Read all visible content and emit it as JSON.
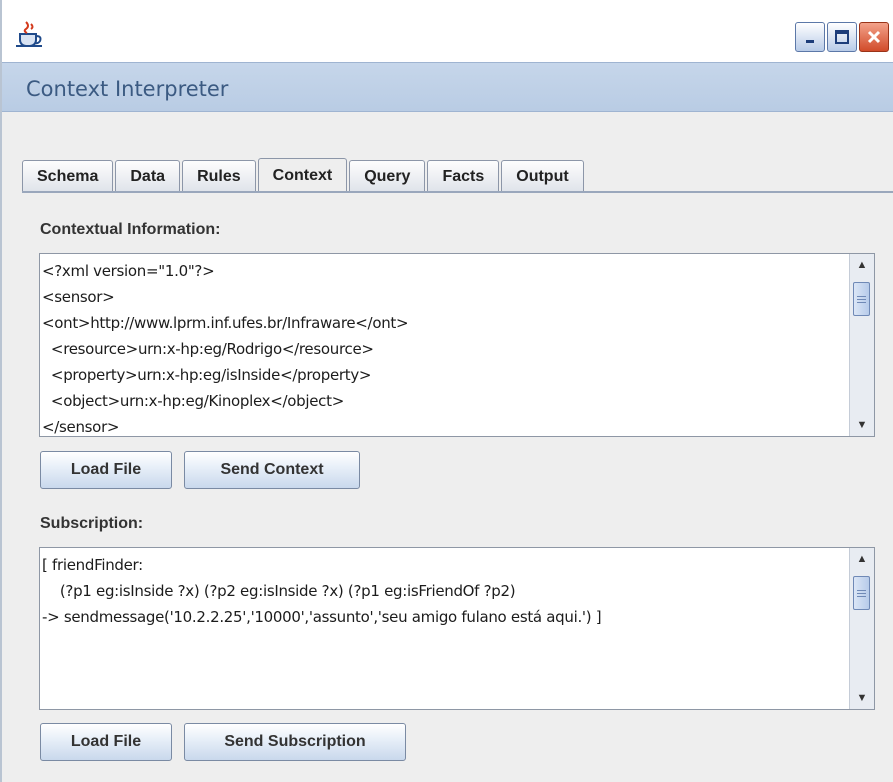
{
  "window": {
    "icon": "java-cup-icon",
    "header_title": "Context Interpreter"
  },
  "tabs": [
    {
      "label": "Schema"
    },
    {
      "label": "Data"
    },
    {
      "label": "Rules"
    },
    {
      "label": "Context",
      "active": true
    },
    {
      "label": "Query"
    },
    {
      "label": "Facts"
    },
    {
      "label": "Output"
    }
  ],
  "context_panel": {
    "contextual_label": "Contextual Information:",
    "contextual_text": "<?xml version=\"1.0\"?>\n<sensor>\n<ont>http://www.lprm.inf.ufes.br/Infraware</ont>\n  <resource>urn:x-hp:eg/Rodrigo</resource>\n  <property>urn:x-hp:eg/isInside</property>\n  <object>urn:x-hp:eg/Kinoplex</object>\n</sensor>",
    "load_file_label": "Load File",
    "send_context_label": "Send Context",
    "subscription_label": "Subscription:",
    "subscription_text": "[ friendFinder:\n    (?p1 eg:isInside ?x) (?p2 eg:isInside ?x) (?p1 eg:isFriendOf ?p2)\n-> sendmessage('10.2.2.25','10000','assunto','seu amigo fulano está aqui.') ]",
    "load_file_label_2": "Load File",
    "send_subscription_label": "Send Subscription"
  }
}
